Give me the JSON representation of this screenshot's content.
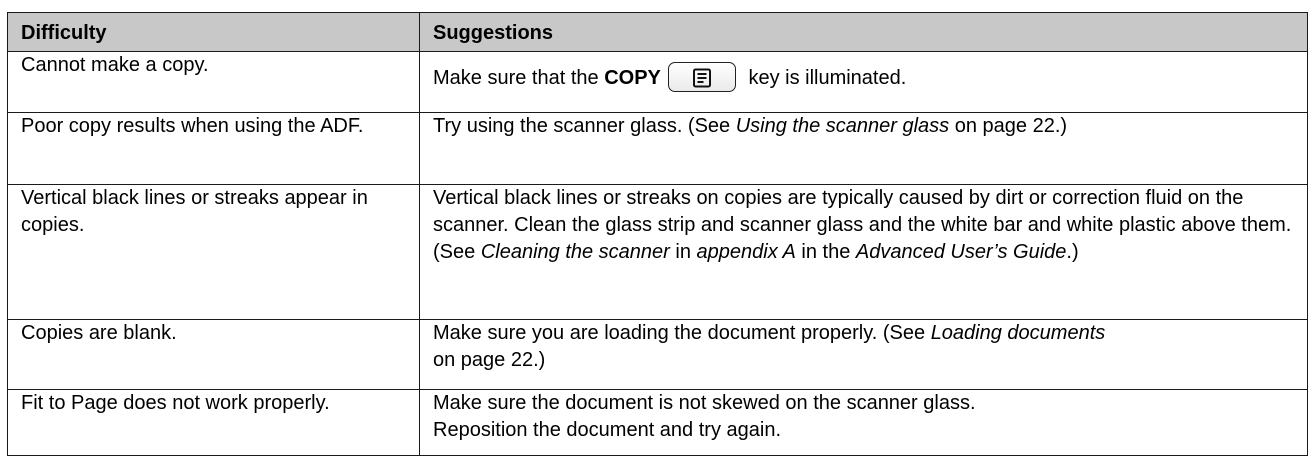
{
  "table": {
    "headers": {
      "difficulty": "Difficulty",
      "suggestions": "Suggestions"
    },
    "rows": [
      {
        "difficulty": "Cannot make a copy.",
        "suggestion": {
          "pre": "Make sure that the ",
          "bold": "COPY",
          "key_icon": "copy-key-icon",
          "post": " key is illuminated."
        }
      },
      {
        "difficulty": "Poor copy results when using the ADF.",
        "suggestion": {
          "pre": "Try using the scanner glass. (See ",
          "italic": "Using the scanner glass",
          "post": " on page 22.)"
        }
      },
      {
        "difficulty": "Vertical black lines or streaks appear in copies.",
        "suggestion": {
          "pre": "Vertical black lines or streaks on copies are typically caused by dirt or correction fluid on the scanner. Clean the glass strip and scanner glass and the white bar and white plastic above them. (See ",
          "italic1": "Cleaning the scanner",
          "mid1": " in ",
          "italic2": "appendix A",
          "mid2": " in the ",
          "italic3": "Advanced User’s Guide",
          "post": ".)"
        }
      },
      {
        "difficulty": "Copies are blank.",
        "suggestion": {
          "pre": "Make sure you are loading the document properly. (See ",
          "italic": "Loading documents",
          "post": " on page 22.)"
        }
      },
      {
        "difficulty": "Fit to Page does not work properly.",
        "suggestion": {
          "line1": "Make sure the document is not skewed on the scanner glass.",
          "line2": "Reposition the document and try again."
        }
      }
    ]
  }
}
